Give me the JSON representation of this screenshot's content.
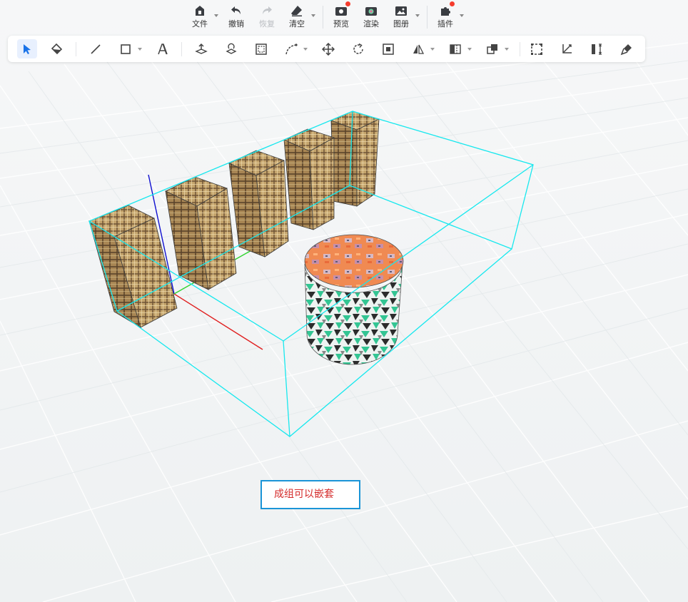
{
  "toolbar": {
    "file": "文件",
    "undo": "撤销",
    "redo": "恢复",
    "clear": "清空",
    "preview": "预览",
    "render": "渲染",
    "gallery": "图册",
    "plugins": "插件"
  },
  "tools": [
    {
      "icon": "select-arrow-icon",
      "active": true
    },
    {
      "icon": "paint-bucket-icon"
    },
    {
      "icon": "line-icon"
    },
    {
      "icon": "rectangle-icon",
      "dropdown": true
    },
    {
      "icon": "text-3d-icon"
    },
    {
      "icon": "push-pull-icon"
    },
    {
      "icon": "rotate-surface-icon"
    },
    {
      "icon": "offset-icon"
    },
    {
      "icon": "curve-icon",
      "dropdown": true
    },
    {
      "icon": "move-icon"
    },
    {
      "icon": "rotate-icon"
    },
    {
      "icon": "scale-icon"
    },
    {
      "icon": "mirror-icon",
      "dropdown": true
    },
    {
      "icon": "align-icon",
      "dropdown": true
    },
    {
      "icon": "boolean-icon",
      "dropdown": true
    },
    {
      "icon": "group-icon"
    },
    {
      "icon": "tape-measure-icon"
    },
    {
      "icon": "dimension-icon"
    },
    {
      "icon": "material-brush-icon"
    }
  ],
  "annotation": {
    "text": "成组可以嵌套"
  },
  "colors": {
    "accent": "#1a94d7",
    "selection_box": "#17e8ee",
    "axis_x": "#e02020",
    "axis_y": "#2fd42f",
    "axis_z": "#1010d0",
    "notification": "#f53c2d"
  }
}
